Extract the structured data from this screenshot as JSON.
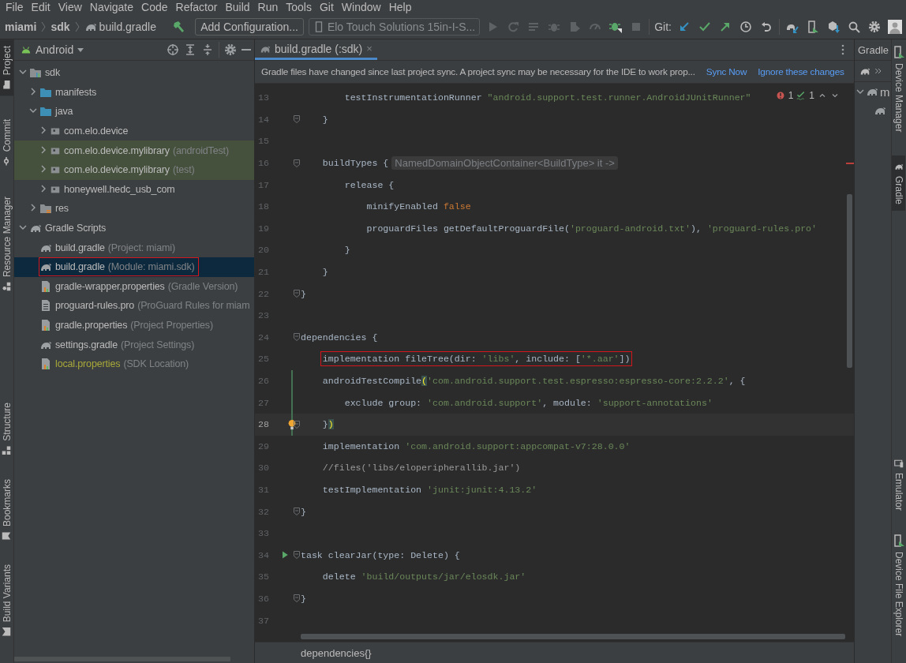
{
  "menu": [
    "File",
    "Edit",
    "View",
    "Navigate",
    "Code",
    "Refactor",
    "Build",
    "Run",
    "Tools",
    "Git",
    "Window",
    "Help"
  ],
  "navbar": {
    "breadcrumbs": [
      {
        "label": "miami",
        "kind": "folder"
      },
      {
        "label": "sdk",
        "kind": "folder"
      },
      {
        "label": "build.gradle",
        "kind": "gradle"
      }
    ],
    "run_config": "Add Configuration...",
    "device": "Elo Touch Solutions 15in-I-S...",
    "actions": [
      {
        "kind": "run",
        "disabled": true
      },
      {
        "kind": "rerun",
        "disabled": true
      },
      {
        "kind": "apply",
        "disabled": true
      },
      {
        "kind": "debug",
        "disabled": true
      },
      {
        "kind": "profile",
        "disabled": true
      },
      {
        "kind": "gauge",
        "disabled": true
      },
      {
        "kind": "attach",
        "disabled": false
      },
      {
        "kind": "stop",
        "disabled": true
      }
    ],
    "git_label": "Git:",
    "git_actions": [
      {
        "kind": "update"
      },
      {
        "kind": "commit"
      },
      {
        "kind": "push"
      },
      {
        "kind": "history"
      },
      {
        "kind": "rollback"
      }
    ],
    "tools": [
      {
        "kind": "sync"
      },
      {
        "kind": "device"
      },
      {
        "kind": "sdk"
      },
      {
        "kind": "search"
      },
      {
        "kind": "settings"
      },
      {
        "kind": "avatar"
      }
    ]
  },
  "left_stripe": {
    "top": [
      {
        "label": "Project",
        "kind": "project",
        "selected": true
      },
      {
        "label": "Commit",
        "kind": "commit",
        "selected": false
      },
      {
        "label": "Resource Manager",
        "kind": "resources",
        "selected": false
      }
    ],
    "bottom": [
      {
        "label": "Structure",
        "kind": "structure",
        "selected": false
      },
      {
        "label": "Bookmarks",
        "kind": "bookmarks",
        "selected": false
      },
      {
        "label": "Build Variants",
        "kind": "variants",
        "selected": false
      }
    ]
  },
  "project_panel": {
    "view": "Android",
    "tree": [
      {
        "label": "sdk",
        "kind": "module",
        "expanded": true,
        "selected": false,
        "children": [
          {
            "label": "manifests",
            "kind": "folder",
            "expanded": false,
            "selected": false
          },
          {
            "label": "java",
            "kind": "folder",
            "expanded": true,
            "selected": false,
            "children": [
              {
                "label": "com.elo.device",
                "kind": "package",
                "expanded": false,
                "selected": false
              },
              {
                "label": "com.elo.device.mylibrary",
                "note": "(androidTest)",
                "kind": "package",
                "expanded": false,
                "selected": false,
                "tinted": true
              },
              {
                "label": "com.elo.device.mylibrary",
                "note": "(test)",
                "kind": "package",
                "expanded": false,
                "selected": false,
                "tinted": true
              },
              {
                "label": "honeywell.hedc_usb_com",
                "kind": "package",
                "expanded": false,
                "selected": false
              }
            ]
          },
          {
            "label": "res",
            "kind": "res",
            "expanded": false,
            "selected": false
          }
        ]
      },
      {
        "label": "Gradle Scripts",
        "kind": "gradle",
        "expanded": true,
        "selected": false,
        "children": [
          {
            "label": "build.gradle",
            "note": "(Project: miami)",
            "kind": "gradle",
            "selected": false
          },
          {
            "label": "build.gradle",
            "note": "(Module: miami.sdk)",
            "kind": "gradle",
            "selected": true,
            "outlined": true
          },
          {
            "label": "gradle-wrapper.properties",
            "note": "(Gradle Version)",
            "kind": "properties",
            "selected": false
          },
          {
            "label": "proguard-rules.pro",
            "note": "(ProGuard Rules for miam",
            "kind": "file",
            "selected": false
          },
          {
            "label": "gradle.properties",
            "note": "(Project Properties)",
            "kind": "properties",
            "selected": false
          },
          {
            "label": "settings.gradle",
            "note": "(Project Settings)",
            "kind": "gradle",
            "selected": false
          },
          {
            "label": "local.properties",
            "note": "(SDK Location)",
            "kind": "properties",
            "selected": false,
            "ignored": true
          }
        ]
      }
    ]
  },
  "editor": {
    "tabs": [
      {
        "label": "build.gradle (:sdk)",
        "close": "×",
        "selected": true
      }
    ],
    "banner": {
      "message": "Gradle files have changed since last project sync. A project sync may be necessary for the IDE to work prop...",
      "actions": [
        "Sync Now",
        "Ignore these changes"
      ]
    },
    "inspections": {
      "errors": "1",
      "typos": "1"
    },
    "lines": [
      {
        "number": "13",
        "segments": [
          {
            "kind": "plain",
            "text": "        testInstrumentationRunner "
          },
          {
            "kind": "string",
            "text": "\"android.support.test.runner.AndroidJUnitRunner\""
          }
        ]
      },
      {
        "number": "14",
        "fold": true,
        "segments": [
          {
            "kind": "plain",
            "text": "    }"
          }
        ]
      },
      {
        "number": "15"
      },
      {
        "number": "16",
        "fold": true,
        "segments": [
          {
            "kind": "plain",
            "text": "    buildTypes {"
          }
        ],
        "hint": "NamedDomainObjectContainer<BuildType> it ->"
      },
      {
        "number": "17",
        "segments": [
          {
            "kind": "plain",
            "text": "        release {"
          }
        ]
      },
      {
        "number": "18",
        "segments": [
          {
            "kind": "plain",
            "text": "            minifyEnabled "
          },
          {
            "kind": "keyword",
            "text": "false"
          }
        ]
      },
      {
        "number": "19",
        "segments": [
          {
            "kind": "plain",
            "text": "            proguardFiles getDefaultProguardFile("
          },
          {
            "kind": "string",
            "text": "'proguard-android.txt'"
          },
          {
            "kind": "plain",
            "text": "), "
          },
          {
            "kind": "string",
            "text": "'proguard-rules.pro'"
          }
        ]
      },
      {
        "number": "20",
        "segments": [
          {
            "kind": "plain",
            "text": "        }"
          }
        ]
      },
      {
        "number": "21",
        "segments": [
          {
            "kind": "plain",
            "text": "    }"
          }
        ]
      },
      {
        "number": "22",
        "fold": true,
        "segments": [
          {
            "kind": "plain",
            "text": "}"
          }
        ]
      },
      {
        "number": "23"
      },
      {
        "number": "24",
        "fold": true,
        "segments": [
          {
            "kind": "plain",
            "text": "dependencies {"
          }
        ]
      },
      {
        "number": "25",
        "outlined": true,
        "segments": [
          {
            "kind": "plain",
            "text": "    implementation fileTree(dir: "
          },
          {
            "kind": "string",
            "text": "'libs'"
          },
          {
            "kind": "plain",
            "text": ", include: ["
          },
          {
            "kind": "string",
            "text": "'*.aar'"
          },
          {
            "kind": "plain",
            "text": "])"
          }
        ]
      },
      {
        "number": "26",
        "changed": true,
        "segments": [
          {
            "kind": "plain",
            "text": "    androidTestCompile"
          },
          {
            "kind": "match",
            "text": "("
          },
          {
            "kind": "string",
            "text": "'com.android.support.test.espresso:espresso-core:2.2.2'"
          },
          {
            "kind": "plain",
            "text": ", {"
          }
        ]
      },
      {
        "number": "27",
        "changed": true,
        "segments": [
          {
            "kind": "plain",
            "text": "        exclude group: "
          },
          {
            "kind": "string",
            "text": "'com.android.support'"
          },
          {
            "kind": "plain",
            "text": ", module: "
          },
          {
            "kind": "string",
            "text": "'support-annotations'"
          }
        ]
      },
      {
        "number": "28",
        "changed": true,
        "current": true,
        "fold": true,
        "intention": true,
        "segments": [
          {
            "kind": "plain",
            "text": "    }"
          },
          {
            "kind": "match",
            "text": ")"
          }
        ]
      },
      {
        "number": "29",
        "segments": [
          {
            "kind": "plain",
            "text": "    implementation "
          },
          {
            "kind": "string",
            "text": "'com.android.support:appcompat-v7:28.0.0'"
          }
        ]
      },
      {
        "number": "30",
        "segments": [
          {
            "kind": "comment",
            "text": "    //files('libs/eloperipherallib.jar')"
          }
        ]
      },
      {
        "number": "31",
        "segments": [
          {
            "kind": "plain",
            "text": "    testImplementation "
          },
          {
            "kind": "string",
            "text": "'junit:junit:4.13.2'"
          }
        ]
      },
      {
        "number": "32",
        "fold": true,
        "segments": [
          {
            "kind": "plain",
            "text": "}"
          }
        ]
      },
      {
        "number": "33"
      },
      {
        "number": "34",
        "fold": true,
        "runnable": true,
        "segments": [
          {
            "kind": "plain",
            "text": "task clearJar(type: Delete) {"
          }
        ]
      },
      {
        "number": "35",
        "segments": [
          {
            "kind": "plain",
            "text": "    delete "
          },
          {
            "kind": "string",
            "text": "'build/outputs/jar/elosdk.jar'"
          }
        ]
      },
      {
        "number": "36",
        "fold": true,
        "segments": [
          {
            "kind": "plain",
            "text": "}"
          }
        ]
      },
      {
        "number": "37"
      }
    ],
    "breadcrumb": "dependencies{}"
  },
  "gradle_panel": {
    "title": "Gradle",
    "tree": [
      {
        "label": "m",
        "expanded": true
      }
    ]
  },
  "right_stripe": {
    "top": [
      {
        "label": "Device Manager",
        "kind": "device",
        "selected": false
      },
      {
        "label": "Gradle",
        "kind": "gradle",
        "selected": true
      }
    ],
    "bottom": [
      {
        "label": "Emulator",
        "kind": "emulator",
        "selected": false
      },
      {
        "label": "Device File Explorer",
        "kind": "device",
        "selected": false
      }
    ]
  }
}
